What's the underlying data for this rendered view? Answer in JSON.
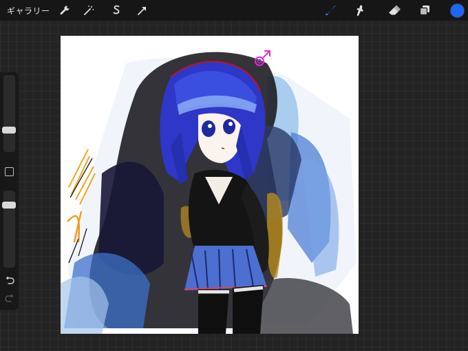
{
  "toolbar": {
    "gallery_label": "ギャラリー",
    "left_tools": [
      "wrench-icon",
      "magic-wand-icon",
      "selection-icon",
      "transform-arrow-icon"
    ],
    "right_tools": [
      "brush-icon",
      "smudge-icon",
      "eraser-icon",
      "layers-icon"
    ],
    "active_tool": "brush-icon",
    "current_color": "#1a66ff"
  },
  "sidebar": {
    "brush_size_level": 0.5,
    "opacity_level": 0.12,
    "icons": [
      "modify-square-icon",
      "undo-icon",
      "redo-icon"
    ]
  },
  "artwork": {
    "subject": "anime-girl-blue-hair",
    "symbol_color": "#e02bd2"
  }
}
